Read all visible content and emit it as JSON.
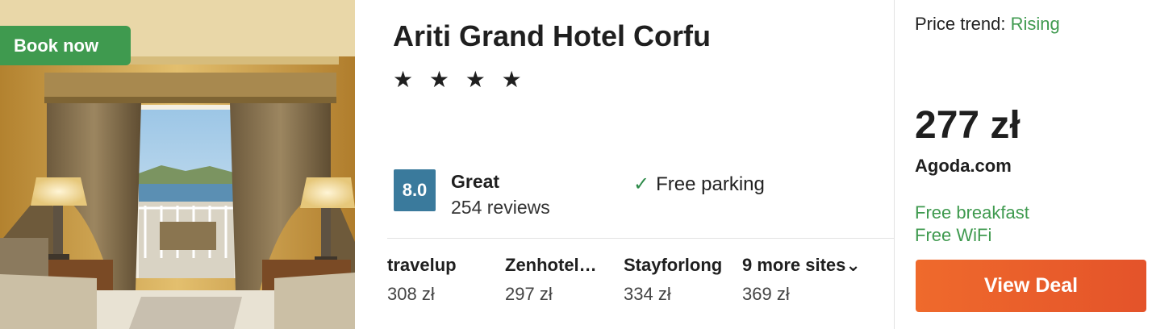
{
  "badge": {
    "label": "Book now"
  },
  "hotel": {
    "name": "Ariti Grand Hotel Corfu",
    "stars": "★ ★ ★ ★",
    "star_count": 4
  },
  "rating": {
    "score": "8.0",
    "word": "Great",
    "reviews": "254 reviews"
  },
  "amenity": {
    "icon": "check-icon",
    "label": "Free parking"
  },
  "providers": [
    {
      "name": "travelup",
      "price": "308 zł"
    },
    {
      "name": "Zenhotel…",
      "price": "297 zł"
    },
    {
      "name": "Stayforlong",
      "price": "334 zł"
    },
    {
      "name": "9 more sites",
      "price": "369 zł"
    }
  ],
  "deal": {
    "trend_label": "Price trend:",
    "trend_value": "Rising",
    "price": "277 zł",
    "site": "Agoda.com",
    "perks": [
      "Free breakfast",
      "Free WiFi"
    ],
    "button_label": "View Deal"
  },
  "colors": {
    "accent_green": "#3f9a4f",
    "score_blue": "#3a7a9c",
    "deal_orange": "#ef6a2c"
  }
}
